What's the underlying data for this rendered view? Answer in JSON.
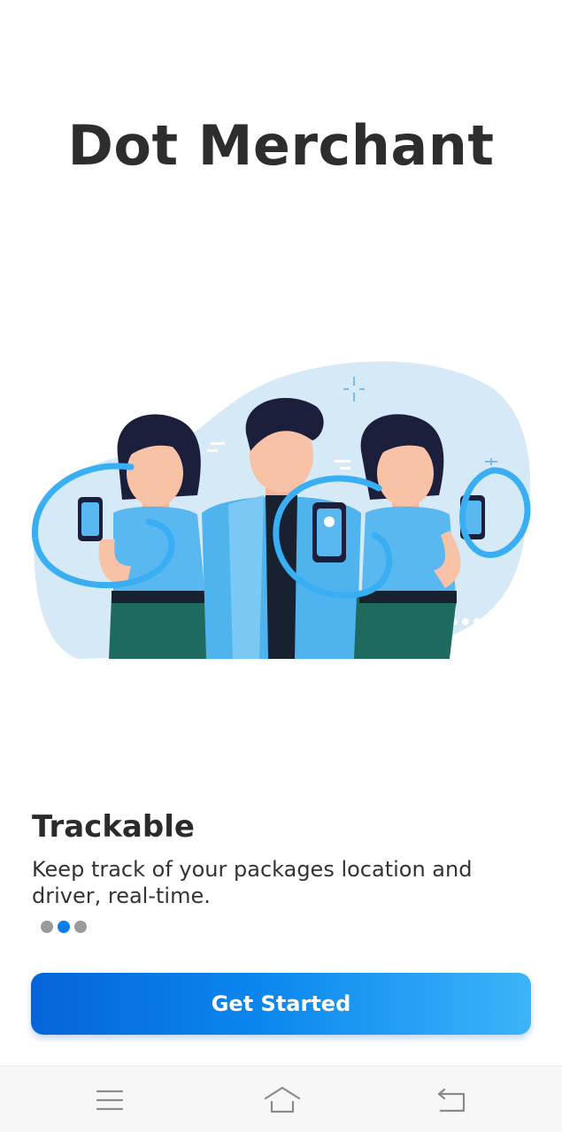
{
  "app": {
    "title": "Dot Merchant"
  },
  "illustration": {
    "subject": "people-holding-phones"
  },
  "slide": {
    "title": "Trackable",
    "description": "Keep track of your packages location and driver, real-time.",
    "pager": {
      "total": 3,
      "active_index": 1
    }
  },
  "cta": {
    "label": "Get Started"
  },
  "navbar": {
    "icons": [
      "menu-icon",
      "home-icon",
      "back-icon"
    ]
  },
  "colors": {
    "accent": "#0a7de8",
    "button_gradient_start": "#0564d9",
    "button_gradient_end": "#3cb4f9",
    "illustration_blob": "#d6e9f7"
  }
}
